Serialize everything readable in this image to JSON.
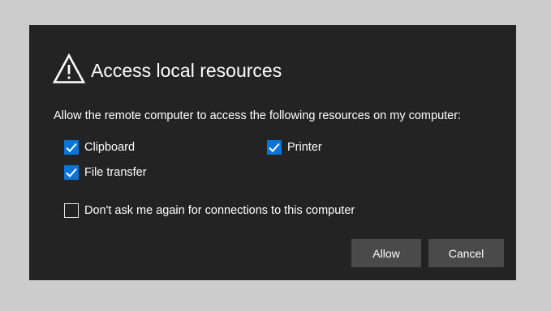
{
  "dialog": {
    "icon": "warning-triangle-icon",
    "title": "Access local resources",
    "description": "Allow the remote computer to access the following resources on my computer:",
    "resources": {
      "clipboard": {
        "label": "Clipboard",
        "checked": true
      },
      "printer": {
        "label": "Printer",
        "checked": true
      },
      "file_transfer": {
        "label": "File transfer",
        "checked": true
      }
    },
    "dont_ask": {
      "label": "Don't ask me again for connections to this computer",
      "checked": false
    },
    "buttons": {
      "allow": "Allow",
      "cancel": "Cancel"
    }
  },
  "colors": {
    "page_background": "#cccccc",
    "dialog_background": "#232323",
    "checkbox_accent": "#0a74d6",
    "button_background": "#4a4a4a",
    "text": "#ffffff"
  }
}
